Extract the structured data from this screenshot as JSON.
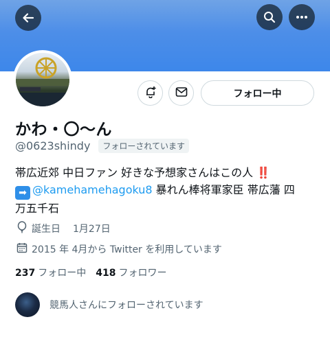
{
  "header": {
    "back_icon": "arrow-left-icon",
    "search_icon": "search-icon",
    "more_icon": "more-horizontal-icon",
    "banner_color": "#4d8ee8"
  },
  "actions": {
    "notify_icon": "bell-plus-icon",
    "message_icon": "envelope-icon",
    "follow_label": "フォロー中"
  },
  "profile": {
    "name": "かわ・〇〜ん",
    "handle": "@0623shindy",
    "follows_you_badge": "フォローされています",
    "bio_line1": "帯広近郊 中日ファン 好きな予想家さんはこの人",
    "bio_line1_emoji": "‼️",
    "bio_line2_arrow": "➡",
    "bio_mention": "@kamehamehagoku8",
    "bio_line2_rest": " 暴れん棒将軍家臣 帯広藩 四",
    "bio_line3": "万五千石",
    "birthday_label": "誕生日",
    "birthday_value": "1月27日",
    "joined_text": "2015 年 4月から Twitter を利用しています"
  },
  "stats": {
    "following_count": "237",
    "following_label": "フォロー中",
    "followers_count": "418",
    "followers_label": "フォロワー"
  },
  "followed_by": {
    "text": "競馬人さんにフォローされています"
  },
  "colors": {
    "link": "#1d9bf0",
    "secondary_text": "#536471",
    "border": "#cfd9de"
  }
}
